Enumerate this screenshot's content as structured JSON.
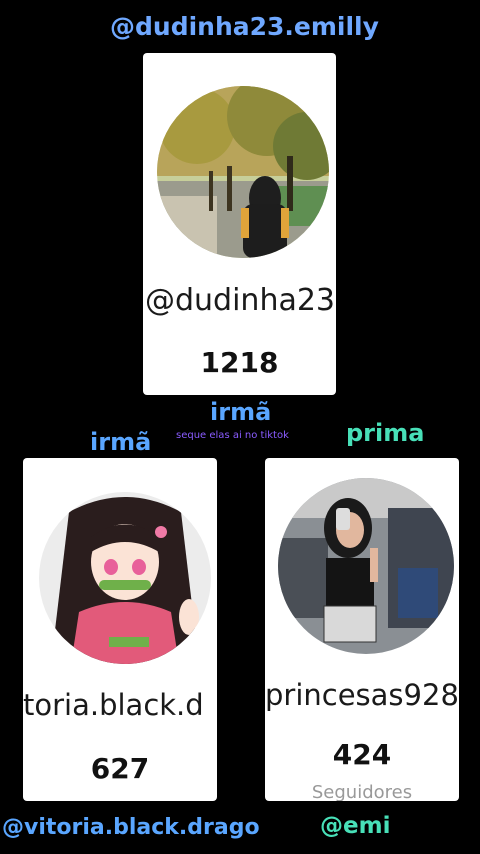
{
  "top": {
    "handle": "@dudinha23.emilly",
    "card_name": "@dudinha23.",
    "count": "1218"
  },
  "center_label": "irmã",
  "center_sub": "seque elas ai no tiktok",
  "left": {
    "tag": "irmã",
    "card_name": "toria.black.d",
    "count": "627",
    "handle": "@vitoria.black.drago"
  },
  "right": {
    "tag": "prima",
    "card_name": "princesas928",
    "count": "424",
    "sub": "Seguidores",
    "handle": "@emi"
  },
  "colors": {
    "handle_blue": "#6fa8ff",
    "tag_blue": "#5aa6ff",
    "tag_teal": "#48e0b8",
    "sub_purple": "#8a5cff"
  }
}
